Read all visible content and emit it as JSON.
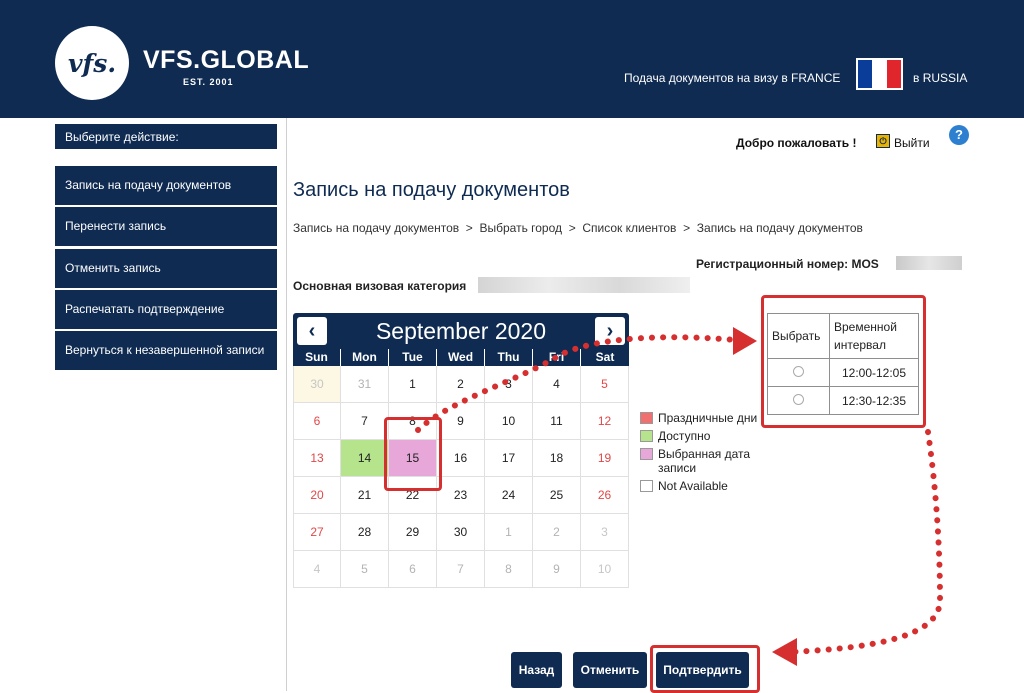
{
  "header": {
    "logo_text": "vfs.",
    "brand": "VFS.GLOBAL",
    "est": "EST. 2001",
    "visa_text": "Подача документов на визу в FRANCE",
    "country_text": "в RUSSIA"
  },
  "sidebar": {
    "title": "Выберите действие:",
    "items": [
      {
        "label": "Запись на подачу документов"
      },
      {
        "label": "Перенести запись"
      },
      {
        "label": "Отменить запись"
      },
      {
        "label": "Распечатать подтверждение"
      },
      {
        "label": "Вернуться к незавершенной записи"
      }
    ]
  },
  "topbar": {
    "welcome": "Добро пожаловать !",
    "logout": "Выйти",
    "help": "?"
  },
  "main": {
    "title": "Запись на подачу документов",
    "breadcrumb": "Запись на подачу документов  >  Выбрать город  >  Список клиентов  >  Запись на подачу документов",
    "reg_label": "Регистрационный номер: MOS",
    "visa_category_label": "Основная визовая категория"
  },
  "calendar": {
    "month_title": "September 2020",
    "prev": "‹",
    "next": "›",
    "days_of_week": [
      "Sun",
      "Mon",
      "Tue",
      "Wed",
      "Thu",
      "Fri",
      "Sat"
    ],
    "weeks": [
      [
        "30",
        "31",
        "1",
        "2",
        "3",
        "4",
        "5"
      ],
      [
        "6",
        "7",
        "8",
        "9",
        "10",
        "11",
        "12"
      ],
      [
        "13",
        "14",
        "15",
        "16",
        "17",
        "18",
        "19"
      ],
      [
        "20",
        "21",
        "22",
        "23",
        "24",
        "25",
        "26"
      ],
      [
        "27",
        "28",
        "29",
        "30",
        "1",
        "2",
        "3"
      ],
      [
        "4",
        "5",
        "6",
        "7",
        "8",
        "9",
        "10"
      ]
    ],
    "available_day": "14",
    "selected_day": "15"
  },
  "legend": [
    {
      "label": "Праздничные дни",
      "color": "#f07070"
    },
    {
      "label": "Доступно",
      "color": "#b6e48c"
    },
    {
      "label": "Выбранная дата записи",
      "color": "#e7a8d9"
    },
    {
      "label": "Not Available",
      "color": "#ffffff"
    }
  ],
  "slots": {
    "headers": [
      "Выбрать",
      "Временной интервал"
    ],
    "rows": [
      {
        "time": "12:00-12:05"
      },
      {
        "time": "12:30-12:35"
      }
    ]
  },
  "buttons": {
    "back": "Назад",
    "cancel": "Отменить",
    "confirm": "Подтвердить"
  },
  "colors": {
    "brand_navy": "#0f2b52",
    "annotation_red": "#d62f2f"
  }
}
